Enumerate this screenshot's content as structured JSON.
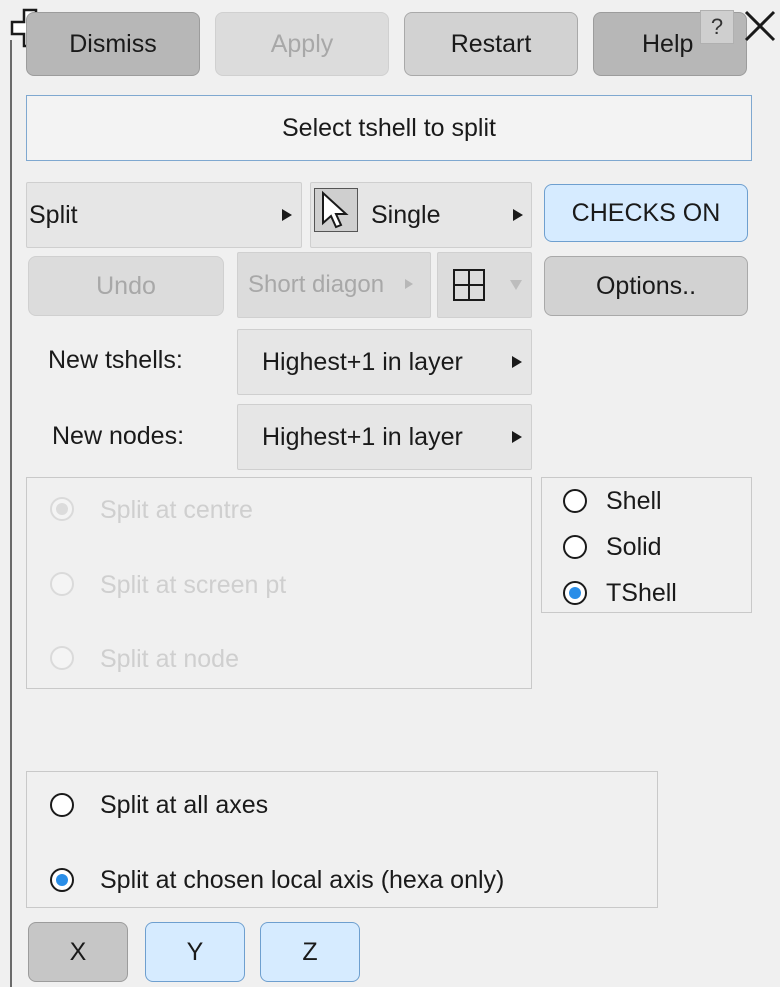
{
  "window": {
    "move_icon": "move-cross-icon",
    "help_icon": "question-icon",
    "close_icon": "close-x-icon",
    "help_glyph": "?",
    "close_glyph": "✕"
  },
  "toolbar": {
    "dismiss": "Dismiss",
    "apply": "Apply",
    "restart": "Restart",
    "help": "Help"
  },
  "prompt": "Select tshell to split",
  "row1": {
    "mode_label": "Split",
    "selection_label": "Single",
    "checks_label": "CHECKS ON"
  },
  "row2": {
    "undo_label": "Undo",
    "diagonal_label": "Short diagon",
    "options_label": "Options.."
  },
  "new_tshells": {
    "label": "New tshells:",
    "value": "Highest+1 in layer"
  },
  "new_nodes": {
    "label": "New nodes:",
    "value": "Highest+1 in layer"
  },
  "split_location": {
    "options": [
      {
        "label": "Split at centre",
        "selected": true
      },
      {
        "label": "Split at screen pt",
        "selected": false
      },
      {
        "label": "Split at node",
        "selected": false
      }
    ]
  },
  "element_type": {
    "options": [
      {
        "label": "Shell",
        "selected": false
      },
      {
        "label": "Solid",
        "selected": false
      },
      {
        "label": "TShell",
        "selected": true
      }
    ]
  },
  "axes_mode": {
    "options": [
      {
        "label": "Split at all axes",
        "selected": false
      },
      {
        "label": "Split at chosen local axis (hexa only)",
        "selected": true
      }
    ]
  },
  "axes": {
    "x": "X",
    "y": "Y",
    "z": "Z"
  },
  "colors": {
    "accent_blue": "#2a8ee8",
    "toggle_blue": "#d6ebff",
    "background": "#f0f0f0"
  }
}
